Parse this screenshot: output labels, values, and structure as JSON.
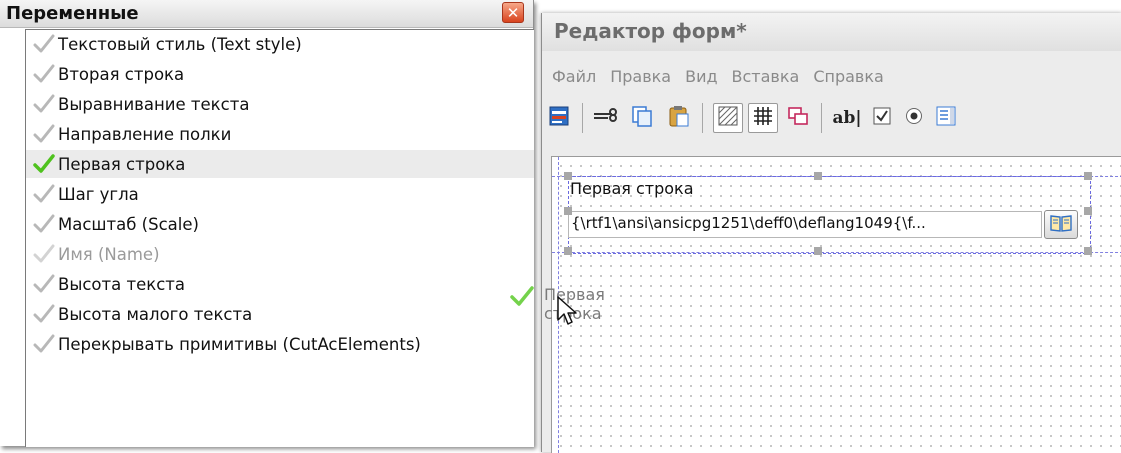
{
  "variables_panel": {
    "title": "Переменные",
    "close_label": "✕",
    "items": [
      {
        "label": "Текстовый стиль (Text style)"
      },
      {
        "label": "Вторая строка"
      },
      {
        "label": "Выравнивание текста"
      },
      {
        "label": "Направление полки"
      },
      {
        "label": "Первая строка"
      },
      {
        "label": "Шаг угла"
      },
      {
        "label": "Масштаб (Scale)"
      },
      {
        "label": "Имя (Name)"
      },
      {
        "label": "Высота текста"
      },
      {
        "label": "Высота малого текста"
      },
      {
        "label": "Перекрывать примитивы (CutAcElements)"
      }
    ],
    "selected_item": "Первая строка",
    "disabled_item": "Имя (Name)"
  },
  "form_editor": {
    "title": "Редактор форм*",
    "menu": [
      "Файл",
      "Правка",
      "Вид",
      "Вставка",
      "Справка"
    ],
    "toolbar": {
      "icons": [
        "form-icon",
        "cut-icon",
        "copy-icon",
        "paste-icon",
        "hatch-icon",
        "grid-icon",
        "layers-icon",
        "textbox-icon",
        "checkbox-icon",
        "radio-icon",
        "listbox-icon"
      ],
      "textbox_label": "ab|"
    },
    "canvas": {
      "field_label": "Первая строка",
      "rtf_value": "{\\rtf1\\ansi\\ansicpg1251\\deff0\\deflang1049{\\f...",
      "drag_label": "Первая строка"
    }
  },
  "colors": {
    "check_green": "#4fc21e",
    "check_gray": "#b8b8b8",
    "guide_blue": "#8080e0",
    "close_red": "#d8431e"
  }
}
